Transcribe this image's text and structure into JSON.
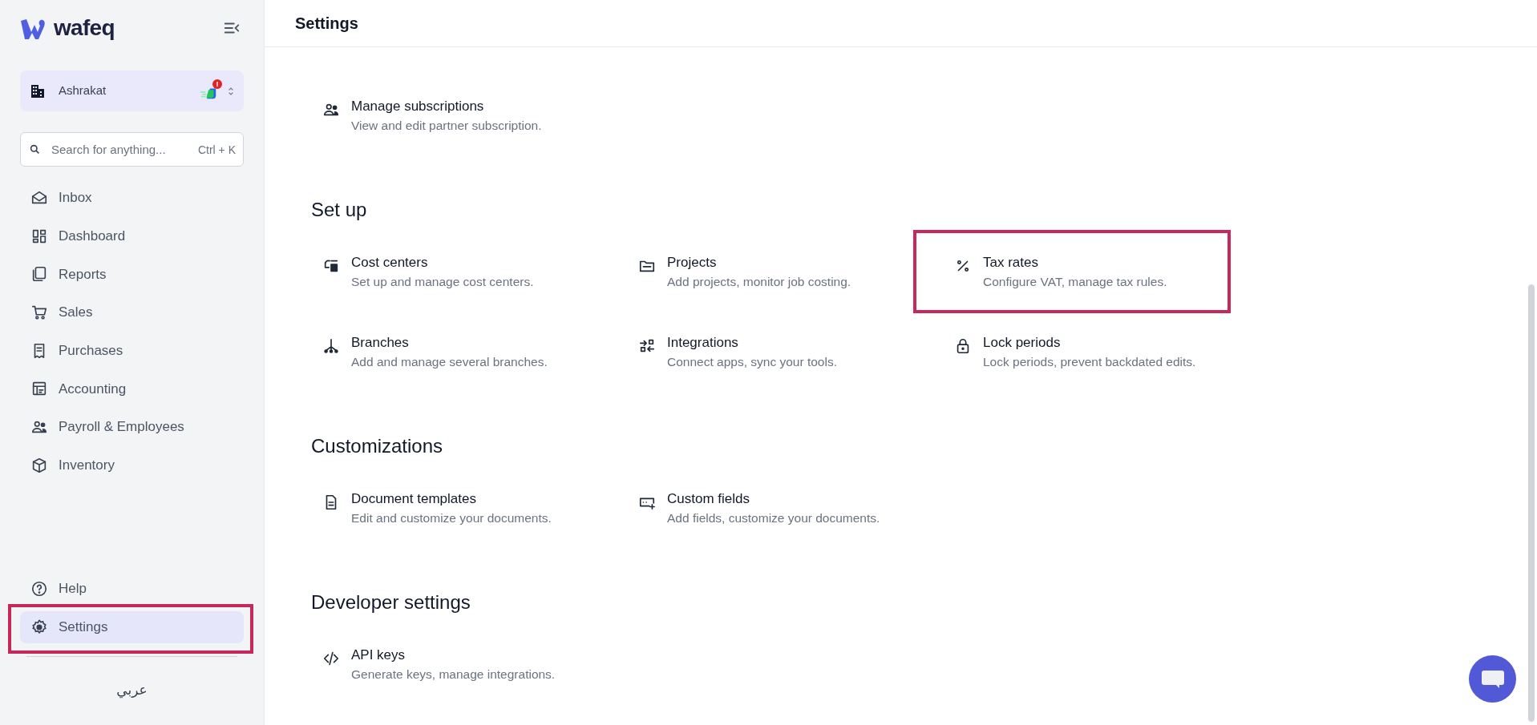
{
  "sidebar": {
    "brand": "wafeq",
    "company": {
      "name": "Ashrakat",
      "alert": "!"
    },
    "search": {
      "placeholder": "Search for anything...",
      "shortcut": "Ctrl + K"
    },
    "nav": [
      {
        "label": "Inbox",
        "selected": false,
        "highlighted": false
      },
      {
        "label": "Dashboard",
        "selected": false,
        "highlighted": false
      },
      {
        "label": "Reports",
        "selected": false,
        "highlighted": false
      },
      {
        "label": "Sales",
        "selected": false,
        "highlighted": false
      },
      {
        "label": "Purchases",
        "selected": false,
        "highlighted": false
      },
      {
        "label": "Accounting",
        "selected": false,
        "highlighted": false
      },
      {
        "label": "Payroll & Employees",
        "selected": false,
        "highlighted": false
      },
      {
        "label": "Inventory",
        "selected": false,
        "highlighted": false
      }
    ],
    "bottom_nav": [
      {
        "label": "Help",
        "selected": false,
        "highlighted": false
      },
      {
        "label": "Settings",
        "selected": true,
        "highlighted": true
      }
    ],
    "language": "عربي"
  },
  "header": {
    "title": "Settings"
  },
  "sections": [
    {
      "items": [
        {
          "title": "Manage subscriptions",
          "description": "View and edit partner subscription.",
          "highlighted": false
        }
      ]
    },
    {
      "title": "Set up",
      "items": [
        {
          "title": "Cost centers",
          "description": "Set up and manage cost centers.",
          "highlighted": false
        },
        {
          "title": "Projects",
          "description": "Add projects, monitor job costing.",
          "highlighted": false
        },
        {
          "title": "Tax rates",
          "description": "Configure VAT, manage tax rules.",
          "highlighted": true
        },
        {
          "title": "Branches",
          "description": "Add and manage several branches.",
          "highlighted": false
        },
        {
          "title": "Integrations",
          "description": "Connect apps, sync your tools.",
          "highlighted": false
        },
        {
          "title": "Lock periods",
          "description": "Lock periods, prevent backdated edits.",
          "highlighted": false
        }
      ]
    },
    {
      "title": "Customizations",
      "items": [
        {
          "title": "Document templates",
          "description": "Edit and customize your documents.",
          "highlighted": false
        },
        {
          "title": "Custom fields",
          "description": "Add fields, customize your documents.",
          "highlighted": false
        }
      ]
    },
    {
      "title": "Developer settings",
      "items": [
        {
          "title": "API keys",
          "description": "Generate keys, manage integrations.",
          "highlighted": false
        }
      ]
    }
  ]
}
